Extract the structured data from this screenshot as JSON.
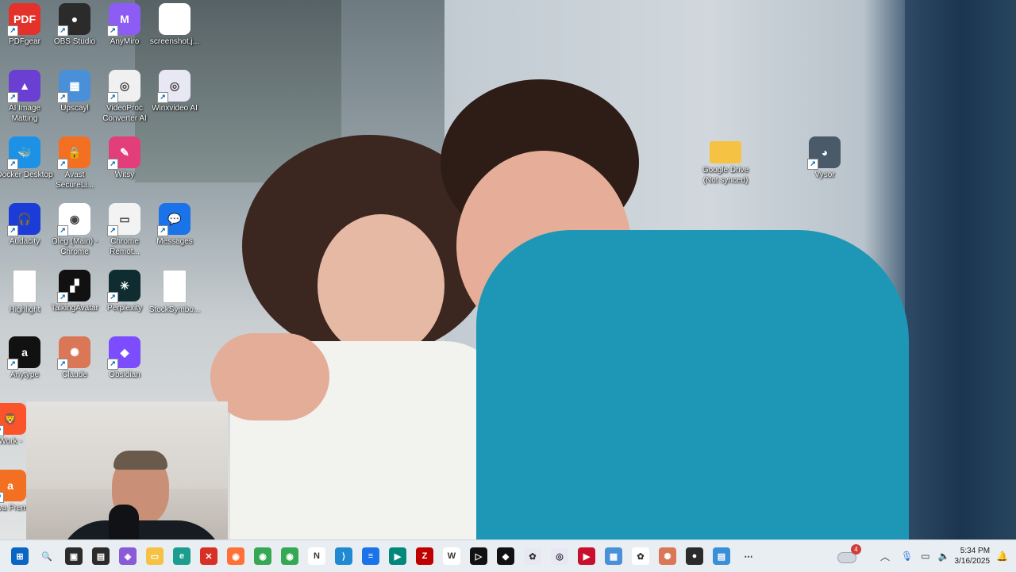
{
  "desktop_icons": [
    {
      "label": "PDFgear",
      "icon": "pdfgear-icon",
      "color": "#e4312a",
      "glyph": "PDF"
    },
    {
      "label": "OBS Studio",
      "icon": "obs-icon",
      "color": "#2b2b2b",
      "glyph": "●"
    },
    {
      "label": "AnyMiro",
      "icon": "anymiro-icon",
      "color": "#8c5cf5",
      "glyph": "M"
    },
    {
      "label": "screenshot.j...",
      "icon": "image-file-icon",
      "color": "#ffffff",
      "glyph": ""
    },
    {
      "label": "AI Image Matting",
      "icon": "ai-matting-icon",
      "color": "#6b3fd1",
      "glyph": "▲"
    },
    {
      "label": "Upscayl",
      "icon": "upscayl-icon",
      "color": "#4a90d9",
      "glyph": "▦"
    },
    {
      "label": "VideoProc Converter AI",
      "icon": "videoproc-icon",
      "color": "#f0f0f0",
      "glyph": "◎"
    },
    {
      "label": "Winxvideo AI",
      "icon": "winxvideo-icon",
      "color": "#e8e8f4",
      "glyph": "◎"
    },
    {
      "label": "Docker Desktop",
      "icon": "docker-icon",
      "color": "#1d91e6",
      "glyph": "🐳"
    },
    {
      "label": "Avast SecureLi...",
      "icon": "avast-secureline-icon",
      "color": "#f36f21",
      "glyph": "🔒"
    },
    {
      "label": "Witsy",
      "icon": "witsy-icon",
      "color": "#e23f7a",
      "glyph": "✎"
    },
    {
      "label": "Audacity",
      "icon": "audacity-icon",
      "color": "#1c3cd8",
      "glyph": "🎧"
    },
    {
      "label": "Oleg (Main) - Chrome",
      "icon": "chrome-icon",
      "color": "#ffffff",
      "glyph": "◉"
    },
    {
      "label": "Chrome Remot...",
      "icon": "chrome-remote-icon",
      "color": "#f3f3f3",
      "glyph": "▭"
    },
    {
      "label": "Messages",
      "icon": "messages-icon",
      "color": "#1a73e8",
      "glyph": "💬"
    },
    {
      "label": "Highlight",
      "icon": "file-icon",
      "color": "#ffffff",
      "glyph": ""
    },
    {
      "label": "TalkingAvatar",
      "icon": "talkingavatar-icon",
      "color": "#111111",
      "glyph": "▞"
    },
    {
      "label": "Perplexity",
      "icon": "perplexity-icon",
      "color": "#0f2c30",
      "glyph": "✳"
    },
    {
      "label": "StockSymbo...",
      "icon": "text-file-icon",
      "color": "#ffffff",
      "glyph": ""
    },
    {
      "label": "Anytype",
      "icon": "anytype-icon",
      "color": "#111111",
      "glyph": "a"
    },
    {
      "label": "Claude",
      "icon": "claude-icon",
      "color": "#d97757",
      "glyph": "✺"
    },
    {
      "label": "Obsidian",
      "icon": "obsidian-icon",
      "color": "#7c4dff",
      "glyph": "◆"
    },
    {
      "label": "Google Drive (Not synced)",
      "icon": "folder-icon",
      "color": "#f6c244",
      "glyph": ""
    },
    {
      "label": "Vysor",
      "icon": "vysor-icon",
      "color": "#4a5a68",
      "glyph": "◕"
    },
    {
      "label": "Work -",
      "icon": "brave-icon",
      "color": "#fb542b",
      "glyph": "🦁"
    },
    {
      "label": "Ava Prem",
      "icon": "avast-icon",
      "color": "#f36f21",
      "glyph": "a"
    }
  ],
  "taskbar": {
    "pinned": [
      {
        "icon": "start-icon",
        "color": "#0a66c2",
        "glyph": "⊞"
      },
      {
        "icon": "search-icon",
        "color": "#e9eef3",
        "glyph": "🔍"
      },
      {
        "icon": "task-view-icon",
        "color": "#2b2b2b",
        "glyph": "▣"
      },
      {
        "icon": "app-icon",
        "color": "#2b2b2b",
        "glyph": "▤"
      },
      {
        "icon": "copilot-icon",
        "color": "#8a5bd6",
        "glyph": "◈"
      },
      {
        "icon": "file-explorer-icon",
        "color": "#f6c244",
        "glyph": "▭"
      },
      {
        "icon": "edge-icon",
        "color": "#1b9e8f",
        "glyph": "e"
      },
      {
        "icon": "app-icon",
        "color": "#d93025",
        "glyph": "✕"
      },
      {
        "icon": "firefox-icon",
        "color": "#ff7139",
        "glyph": "◉"
      },
      {
        "icon": "chrome-icon",
        "color": "#34a853",
        "glyph": "◉"
      },
      {
        "icon": "chrome-profile-icon",
        "color": "#34a853",
        "glyph": "◉"
      },
      {
        "icon": "notion-icon",
        "color": "#ffffff",
        "glyph": "N"
      },
      {
        "icon": "vscode-icon",
        "color": "#1f8ad2",
        "glyph": "⟩"
      },
      {
        "icon": "docs-icon",
        "color": "#1a73e8",
        "glyph": "≡"
      },
      {
        "icon": "meet-icon",
        "color": "#00897b",
        "glyph": "▶"
      },
      {
        "icon": "filezilla-icon",
        "color": "#bf0000",
        "glyph": "Z"
      },
      {
        "icon": "app-w-icon",
        "color": "#ffffff",
        "glyph": "W"
      },
      {
        "icon": "cursor-icon",
        "color": "#111111",
        "glyph": "▷"
      },
      {
        "icon": "app-icon",
        "color": "#111111",
        "glyph": "◆"
      },
      {
        "icon": "app-icon",
        "color": "#e8e8f4",
        "glyph": "✿"
      },
      {
        "icon": "videoproc-icon",
        "color": "#e8e8f4",
        "glyph": "◎"
      },
      {
        "icon": "app-icon",
        "color": "#c8102e",
        "glyph": "▶"
      },
      {
        "icon": "upscayl-icon",
        "color": "#4a90d9",
        "glyph": "▦"
      },
      {
        "icon": "chatgpt-icon",
        "color": "#ffffff",
        "glyph": "✿"
      },
      {
        "icon": "claude-icon",
        "color": "#d97757",
        "glyph": "✺"
      },
      {
        "icon": "obs-icon",
        "color": "#2b2b2b",
        "glyph": "●"
      },
      {
        "icon": "notepad-icon",
        "color": "#3a8fd9",
        "glyph": "▤"
      },
      {
        "icon": "more-icon",
        "color": "#e9eef3",
        "glyph": "⋯"
      }
    ],
    "weather_badge": "4",
    "time": "5:34 PM",
    "date": "3/16/2025"
  }
}
